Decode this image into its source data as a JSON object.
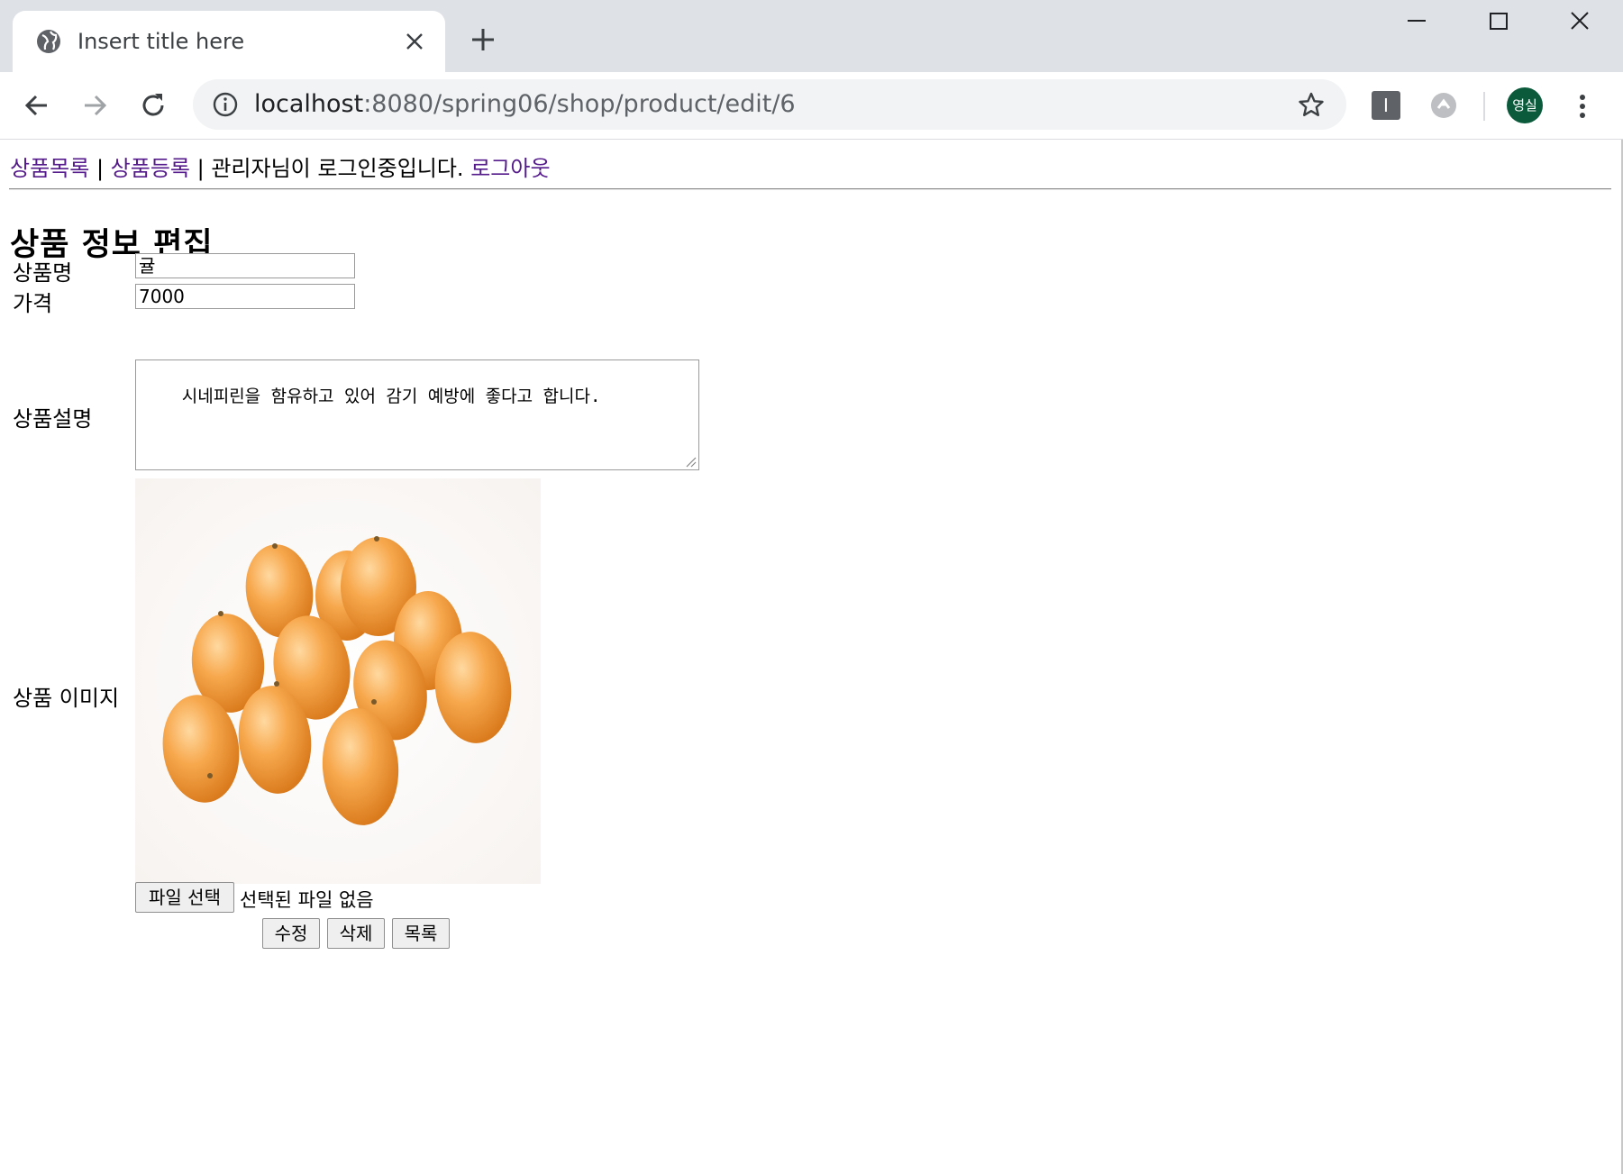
{
  "browser": {
    "tab_title": "Insert title here",
    "url_host": "localhost",
    "url_path": ":8080/spring06/shop/product/edit/6",
    "ext_label": "I",
    "avatar_label": "영실"
  },
  "nav": {
    "product_list": "상품목록",
    "sep1": " | ",
    "product_register": "상품등록",
    "sep2": " | ",
    "login_status": "관리자님이 로그인중입니다. ",
    "logout": "로그아웃"
  },
  "page": {
    "title": "상품 정보 편집"
  },
  "form": {
    "name_label": "상품명",
    "name_value": "귤",
    "price_label": "가격",
    "price_value": "7000",
    "desc_label": "상품설명",
    "desc_value": "시네피린을 함유하고 있어 감기 예방에 좋다고 합니다.",
    "image_label": "상품 이미지",
    "file_button": "파일 선택",
    "file_status": "선택된 파일 없음"
  },
  "actions": {
    "edit": "수정",
    "delete": "삭제",
    "list": "목록"
  },
  "colors": {
    "link": "#551a8b",
    "chrome": "#dee1e6",
    "fruit": "#f4a040"
  }
}
